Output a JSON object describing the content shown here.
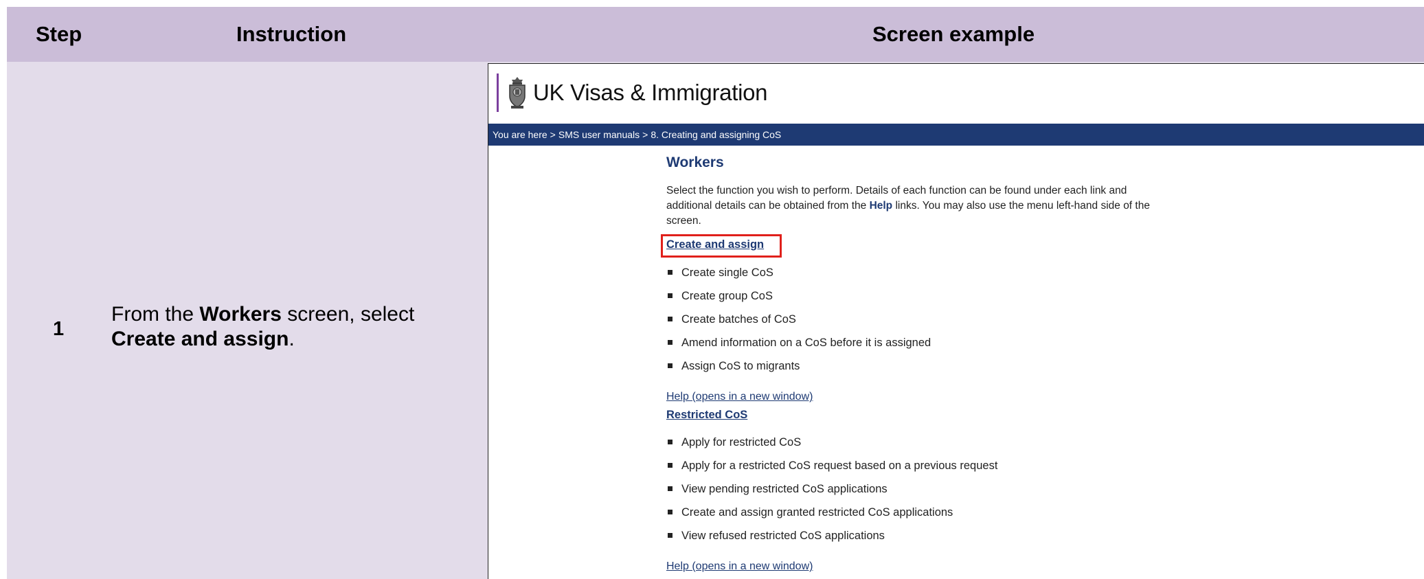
{
  "table": {
    "headers": {
      "step": "Step",
      "instruction": "Instruction",
      "screen_example": "Screen example"
    },
    "row": {
      "step": "1",
      "instruction_parts": {
        "t1": "From the ",
        "b1": "Workers",
        "t2": " screen, select ",
        "b2": "Create and assign",
        "t3": "."
      }
    }
  },
  "screen": {
    "brand": "UK Visas & Immigration",
    "breadcrumb": [
      "You are here",
      ">",
      "SMS user manuals",
      ">",
      "8. Creating and assigning CoS"
    ],
    "page_title": "Workers",
    "description": {
      "t1": "Select the function you wish to perform. Details of each function can be found under each link and additional details can be obtained from the ",
      "help_bold": "Help",
      "t2": " links. You may also use the menu left-hand side of the screen."
    },
    "create_and_assign": {
      "link": "Create and assign",
      "items": [
        "Create single CoS",
        "Create group CoS",
        "Create batches of CoS",
        "Amend information on a CoS before it is assigned",
        "Assign CoS to migrants"
      ],
      "help": "Help (opens in a new window)"
    },
    "restricted": {
      "link": "Restricted CoS",
      "items": [
        "Apply for restricted CoS",
        "Apply for a restricted CoS request based on a previous request",
        "View pending restricted CoS applications",
        "Create and assign granted restricted CoS applications",
        "View refused restricted CoS applications"
      ],
      "help": "Help (opens in a new window)"
    },
    "colors": {
      "header_bg": "#cbbdd8",
      "row_bg": "#e3dcea",
      "nav_blue": "#1e3a73",
      "highlight_red": "#e0201b",
      "brand_bar": "#7b3f9e"
    },
    "icons": {
      "crest": "royal-crest-icon"
    }
  }
}
